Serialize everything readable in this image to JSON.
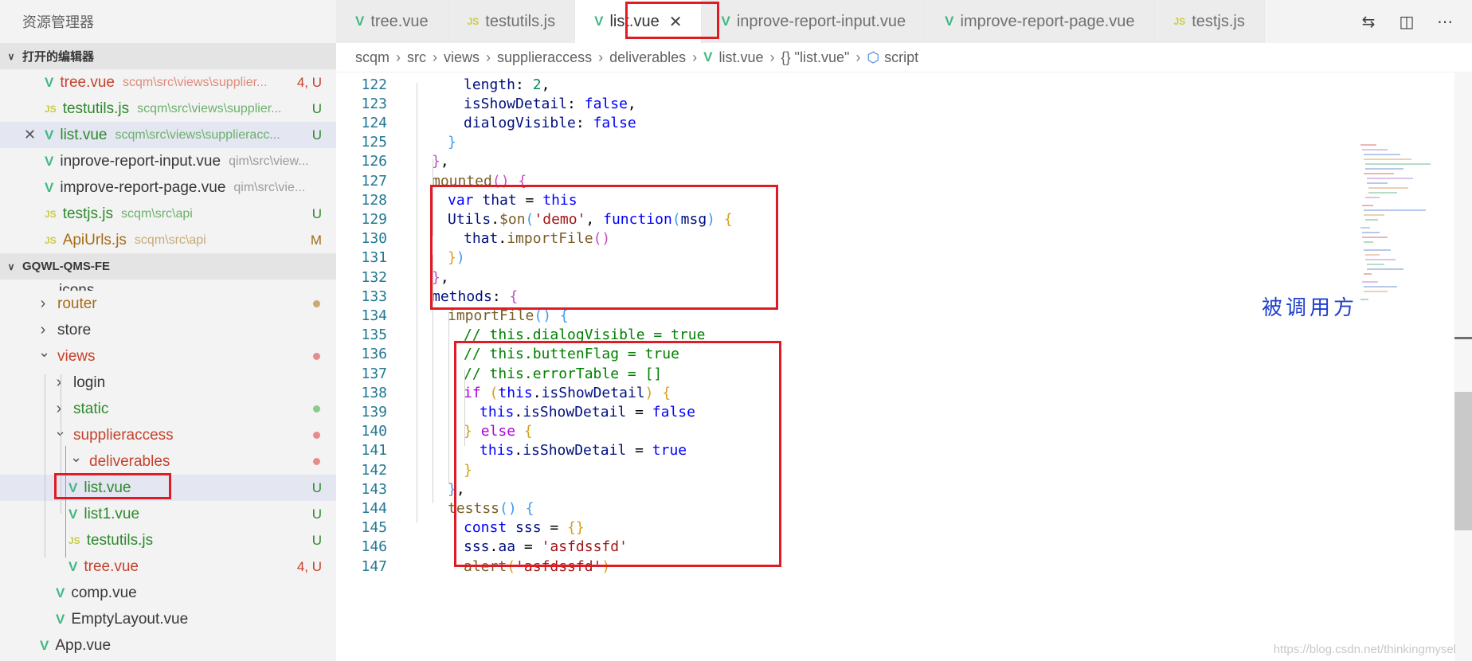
{
  "explorer": {
    "title": "资源管理器",
    "open_editors_header": "打开的编辑器",
    "open_editors": [
      {
        "name": "tree.vue",
        "path": "scqm\\src\\views\\supplier...",
        "badge": "4, U",
        "icon": "vue-icon",
        "name_color": "#c5422c",
        "badge_color": "#c5422c"
      },
      {
        "name": "testutils.js",
        "path": "scqm\\src\\views\\supplier...",
        "badge": "U",
        "icon": "js-icon",
        "name_color": "#2d8a2d",
        "badge_color": "#2d8a2d"
      },
      {
        "name": "list.vue",
        "path": "scqm\\src\\views\\supplieracc...",
        "badge": "U",
        "icon": "vue-icon",
        "name_color": "#2d8a2d",
        "badge_color": "#2d8a2d"
      },
      {
        "name": "inprove-report-input.vue",
        "path": "qim\\src\\view...",
        "badge": "",
        "icon": "vue-icon",
        "name_color": "#383838",
        "badge_color": "#383838"
      },
      {
        "name": "improve-report-page.vue",
        "path": "qim\\src\\vie...",
        "badge": "",
        "icon": "vue-icon",
        "name_color": "#383838",
        "badge_color": "#383838"
      },
      {
        "name": "testjs.js",
        "path": "scqm\\src\\api",
        "badge": "U",
        "icon": "js-icon",
        "name_color": "#2d8a2d",
        "badge_color": "#2d8a2d"
      },
      {
        "name": "ApiUrls.js",
        "path": "scqm\\src\\api",
        "badge": "M",
        "icon": "js-icon",
        "name_color": "#a56b15",
        "badge_color": "#a56b15"
      }
    ],
    "project_header": "GQWL-QMS-FE",
    "partial_item": "icons",
    "tree": [
      {
        "name": "router",
        "type": "folder",
        "level": 1,
        "expanded": false,
        "color": "#a56b15",
        "dot": "#c9a974",
        "badge": ""
      },
      {
        "name": "store",
        "type": "folder",
        "level": 1,
        "expanded": false,
        "color": "#383838",
        "dot": "",
        "badge": ""
      },
      {
        "name": "views",
        "type": "folder",
        "level": 1,
        "expanded": true,
        "color": "#c5422c",
        "dot": "#e78c8c",
        "badge": ""
      },
      {
        "name": "login",
        "type": "folder",
        "level": 2,
        "expanded": false,
        "color": "#383838",
        "dot": "",
        "badge": ""
      },
      {
        "name": "static",
        "type": "folder",
        "level": 2,
        "expanded": false,
        "color": "#2d8a2d",
        "dot": "#8cc98c",
        "badge": ""
      },
      {
        "name": "supplieraccess",
        "type": "folder",
        "level": 2,
        "expanded": true,
        "color": "#c5422c",
        "dot": "#e78c8c",
        "badge": ""
      },
      {
        "name": "deliverables",
        "type": "folder",
        "level": 3,
        "expanded": true,
        "color": "#c5422c",
        "dot": "#e78c8c",
        "badge": ""
      },
      {
        "name": "list.vue",
        "type": "vue",
        "level": 4,
        "color": "#2d8a2d",
        "dot": "",
        "badge": "U"
      },
      {
        "name": "list1.vue",
        "type": "vue",
        "level": 4,
        "color": "#2d8a2d",
        "dot": "",
        "badge": "U"
      },
      {
        "name": "testutils.js",
        "type": "js",
        "level": 4,
        "color": "#2d8a2d",
        "dot": "",
        "badge": "U"
      },
      {
        "name": "tree.vue",
        "type": "vue",
        "level": 4,
        "color": "#c5422c",
        "dot": "",
        "badge": "4, U"
      },
      {
        "name": "comp.vue",
        "type": "vue",
        "level": 2,
        "color": "#383838",
        "dot": "",
        "badge": ""
      },
      {
        "name": "EmptyLayout.vue",
        "type": "vue",
        "level": 2,
        "color": "#383838",
        "dot": "",
        "badge": ""
      },
      {
        "name": "App.vue",
        "type": "vue",
        "level": 1,
        "color": "#383838",
        "dot": "",
        "badge": ""
      }
    ]
  },
  "tabs": [
    {
      "label": "tree.vue",
      "icon": "vue-icon",
      "active": false
    },
    {
      "label": "testutils.js",
      "icon": "js-icon",
      "active": false
    },
    {
      "label": "list.vue",
      "icon": "vue-icon",
      "active": true
    },
    {
      "label": "inprove-report-input.vue",
      "icon": "vue-icon",
      "active": false
    },
    {
      "label": "improve-report-page.vue",
      "icon": "vue-icon",
      "active": false
    },
    {
      "label": "testjs.js",
      "icon": "js-icon",
      "active": false
    }
  ],
  "tab_actions": [
    "compare-changes-icon",
    "split-editor-icon",
    "more-actions-icon"
  ],
  "breadcrumb": [
    "scqm",
    "src",
    "views",
    "supplieraccess",
    "deliverables",
    "list.vue",
    "{} \"list.vue\"",
    "script"
  ],
  "annotation": "被调用方",
  "watermark": "https://blog.csdn.net/thinkingmysel",
  "code_lines": [
    {
      "n": "122",
      "indent": 2,
      "tokens": [
        [
          "var",
          "length"
        ],
        [
          "plain",
          ": "
        ],
        [
          "num",
          "2"
        ],
        [
          "plain",
          ","
        ]
      ]
    },
    {
      "n": "123",
      "indent": 2,
      "tokens": [
        [
          "var",
          "isShowDetail"
        ],
        [
          "plain",
          ": "
        ],
        [
          "kw",
          "false"
        ],
        [
          "plain",
          ","
        ]
      ]
    },
    {
      "n": "124",
      "indent": 2,
      "tokens": [
        [
          "var",
          "dialogVisible"
        ],
        [
          "plain",
          ": "
        ],
        [
          "kw",
          "false"
        ]
      ]
    },
    {
      "n": "125",
      "indent": 1,
      "tokens": [
        [
          "b-b",
          "}"
        ]
      ]
    },
    {
      "n": "126",
      "indent": 0,
      "tokens": [
        [
          "b-p",
          "}"
        ],
        [
          "plain",
          ","
        ]
      ]
    },
    {
      "n": "127",
      "indent": 0,
      "tokens": [
        [
          "fn",
          "mounted"
        ],
        [
          "b-p",
          "()"
        ],
        [
          "plain",
          " "
        ],
        [
          "b-p",
          "{"
        ]
      ]
    },
    {
      "n": "128",
      "indent": 1,
      "tokens": [
        [
          "kw",
          "var"
        ],
        [
          "plain",
          " "
        ],
        [
          "var",
          "that"
        ],
        [
          "plain",
          " = "
        ],
        [
          "kw",
          "this"
        ]
      ]
    },
    {
      "n": "129",
      "indent": 1,
      "tokens": [
        [
          "var",
          "Utils"
        ],
        [
          "plain",
          "."
        ],
        [
          "fn",
          "$on"
        ],
        [
          "b-b",
          "("
        ],
        [
          "str",
          "'demo'"
        ],
        [
          "plain",
          ", "
        ],
        [
          "kw",
          "function"
        ],
        [
          "b-b",
          "("
        ],
        [
          "var",
          "msg"
        ],
        [
          "b-b",
          ")"
        ],
        [
          "plain",
          " "
        ],
        [
          "b-y",
          "{"
        ]
      ]
    },
    {
      "n": "130",
      "indent": 2,
      "tokens": [
        [
          "var",
          "that"
        ],
        [
          "plain",
          "."
        ],
        [
          "fn",
          "importFile"
        ],
        [
          "b-p",
          "()"
        ]
      ]
    },
    {
      "n": "131",
      "indent": 1,
      "tokens": [
        [
          "b-y",
          "}"
        ],
        [
          "b-b",
          ")"
        ]
      ]
    },
    {
      "n": "132",
      "indent": 0,
      "tokens": [
        [
          "b-p",
          "}"
        ],
        [
          "plain",
          ","
        ]
      ]
    },
    {
      "n": "133",
      "indent": 0,
      "tokens": [
        [
          "var",
          "methods"
        ],
        [
          "plain",
          ": "
        ],
        [
          "b-p",
          "{"
        ]
      ]
    },
    {
      "n": "134",
      "indent": 1,
      "tokens": [
        [
          "fn",
          "importFile"
        ],
        [
          "b-b",
          "()"
        ],
        [
          "plain",
          " "
        ],
        [
          "b-b",
          "{"
        ]
      ]
    },
    {
      "n": "135",
      "indent": 2,
      "tokens": [
        [
          "com",
          "// this.dialogVisible = true"
        ]
      ]
    },
    {
      "n": "136",
      "indent": 2,
      "tokens": [
        [
          "com",
          "// this.buttenFlag = true"
        ]
      ]
    },
    {
      "n": "137",
      "indent": 2,
      "tokens": [
        [
          "com",
          "// this.errorTable = []"
        ]
      ]
    },
    {
      "n": "138",
      "indent": 2,
      "tokens": [
        [
          "ctl",
          "if"
        ],
        [
          "plain",
          " "
        ],
        [
          "b-y",
          "("
        ],
        [
          "kw",
          "this"
        ],
        [
          "plain",
          "."
        ],
        [
          "var",
          "isShowDetail"
        ],
        [
          "b-y",
          ")"
        ],
        [
          "plain",
          " "
        ],
        [
          "b-y",
          "{"
        ]
      ]
    },
    {
      "n": "139",
      "indent": 3,
      "tokens": [
        [
          "kw",
          "this"
        ],
        [
          "plain",
          "."
        ],
        [
          "var",
          "isShowDetail"
        ],
        [
          "plain",
          " = "
        ],
        [
          "kw",
          "false"
        ]
      ]
    },
    {
      "n": "140",
      "indent": 2,
      "tokens": [
        [
          "b-y",
          "}"
        ],
        [
          "plain",
          " "
        ],
        [
          "ctl",
          "else"
        ],
        [
          "plain",
          " "
        ],
        [
          "b-y",
          "{"
        ]
      ]
    },
    {
      "n": "141",
      "indent": 3,
      "tokens": [
        [
          "kw",
          "this"
        ],
        [
          "plain",
          "."
        ],
        [
          "var",
          "isShowDetail"
        ],
        [
          "plain",
          " = "
        ],
        [
          "kw",
          "true"
        ]
      ]
    },
    {
      "n": "142",
      "indent": 2,
      "tokens": [
        [
          "b-y",
          "}"
        ]
      ]
    },
    {
      "n": "143",
      "indent": 1,
      "tokens": [
        [
          "b-b",
          "}"
        ],
        [
          "plain",
          ","
        ]
      ]
    },
    {
      "n": "144",
      "indent": 1,
      "tokens": [
        [
          "fn",
          "testss"
        ],
        [
          "b-b",
          "()"
        ],
        [
          "plain",
          " "
        ],
        [
          "b-b",
          "{"
        ]
      ]
    },
    {
      "n": "145",
      "indent": 2,
      "tokens": [
        [
          "kw",
          "const"
        ],
        [
          "plain",
          " "
        ],
        [
          "var",
          "sss"
        ],
        [
          "plain",
          " = "
        ],
        [
          "b-y",
          "{}"
        ]
      ]
    },
    {
      "n": "146",
      "indent": 2,
      "tokens": [
        [
          "var",
          "sss"
        ],
        [
          "plain",
          "."
        ],
        [
          "var",
          "aa"
        ],
        [
          "plain",
          " = "
        ],
        [
          "str",
          "'asfdssfd'"
        ]
      ]
    },
    {
      "n": "147",
      "indent": 2,
      "tokens": [
        [
          "fn",
          "alert"
        ],
        [
          "b-y",
          "("
        ],
        [
          "str",
          "'asfdssfd'"
        ],
        [
          "b-y",
          ")"
        ]
      ]
    }
  ]
}
